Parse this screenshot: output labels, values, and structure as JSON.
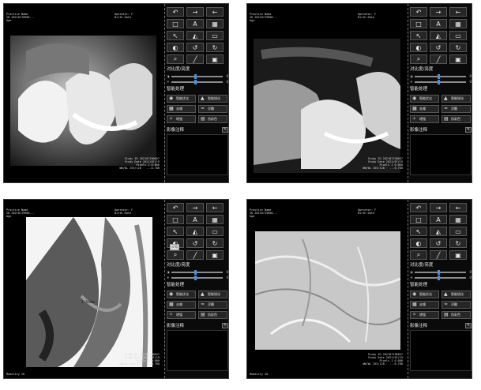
{
  "panels": [
    {
      "id": "p1",
      "overlay": {
        "top_left": [
          "Practice Name",
          "ID 20210719908...",
          "Age"
        ],
        "top_right": [
          "Operator: F",
          "Birth Date",
          ""
        ],
        "bottom_right": [
          "Study ID 202107190657",
          "Study Date 2021/07/19",
          "Pixels 1 0.000",
          "WW/WL 255/128 · ...0.700"
        ],
        "bottom_left": ""
      },
      "measurement": "",
      "tooltip": ""
    },
    {
      "id": "p2",
      "overlay": {
        "top_left": [
          "Practice Name",
          "ID 20210719908...",
          "Age"
        ],
        "top_right": [
          "Operator: F",
          "Birth Date",
          ""
        ],
        "bottom_right": [
          "Study ID 202107190657",
          "Study Date 2021/07/19",
          "Pixels 1 0.000",
          "WW/WL 255/128 · ...0.700"
        ],
        "bottom_left": ""
      },
      "measurement": "",
      "tooltip": ""
    },
    {
      "id": "p3",
      "overlay": {
        "top_left": [
          "Practice Name",
          "ID 20210719908...",
          "Age"
        ],
        "top_right": [
          "Operator: F",
          "Birth Date",
          ""
        ],
        "bottom_right": [
          "Study ID 202107190657",
          "Study Date 2021/07/19",
          "Pixels 1 0.000",
          "WW/WL 255/128 · ...0.700"
        ],
        "bottom_left": "Modality IO"
      },
      "measurement": "3.704mm",
      "tooltip": "反相"
    },
    {
      "id": "p4",
      "overlay": {
        "top_left": [
          "Practice Name",
          "ID 20210719908...",
          "Age"
        ],
        "top_right": [
          "Operator: F",
          "Birth Date",
          ""
        ],
        "bottom_right": [
          "Study ID 202107190657",
          "Study Date 2021/07/19",
          "Pixels 1 0.000",
          "WW/WL 255/128 · ...0.700"
        ],
        "bottom_left": "Modality IO"
      },
      "measurement": "",
      "tooltip": ""
    }
  ],
  "toolbar": {
    "contrast_section": "对比度/亮度",
    "smart_section": "智能处理",
    "image_section": "影像注释",
    "slider_labels": [
      "◑",
      "☀"
    ],
    "slider_ends": [
      "0",
      "0"
    ],
    "contrast_value": 0.45,
    "brightness_value": 0.45,
    "smart_buttons": [
      "智能优化",
      "智能锐化",
      "去噪",
      "浮雕",
      "增强",
      "伪彩色"
    ]
  }
}
